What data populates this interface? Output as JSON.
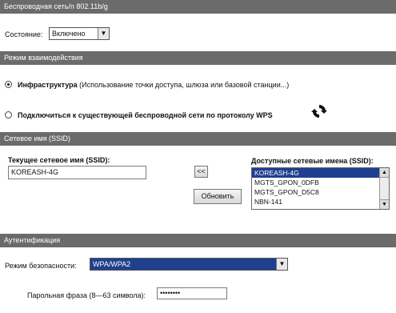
{
  "sections": {
    "wireless": "Беспроводная сеть/n 802.11b/g",
    "mode": "Режим взаимодействия",
    "ssid": "Сетевое имя (SSID)",
    "auth": "Аутентификация"
  },
  "wireless": {
    "state_label": "Состояние:",
    "state_value": "Включено"
  },
  "mode": {
    "infra_bold": "Инфраструктура",
    "infra_desc": " (Использование точки доступа, шлюза или базовой станции...)",
    "wps_label": "Подключиться к существующей беспроводной сети по протоколу WPS",
    "selected": "infrastructure"
  },
  "ssid": {
    "current_label": "Текущее сетевое имя (SSID):",
    "current_value": "KOREASH-4G",
    "copy_button": "<<",
    "refresh_button": "Обновить",
    "available_label": "Доступные сетевые имена (SSID):",
    "networks": [
      "KOREASH-4G",
      "MGTS_GPON_0DFB",
      "MGTS_GPON_D5C8",
      "NBN-141"
    ],
    "selected_index": 0
  },
  "auth": {
    "security_label": "Режим безопасности:",
    "security_value": "WPA/WPA2",
    "passphrase_label": "Парольная фраза (8—63 символа):",
    "passphrase_value": "••••••••"
  },
  "colors": {
    "section_bar": "#6b6b6b",
    "selection": "#1f3f8f"
  }
}
